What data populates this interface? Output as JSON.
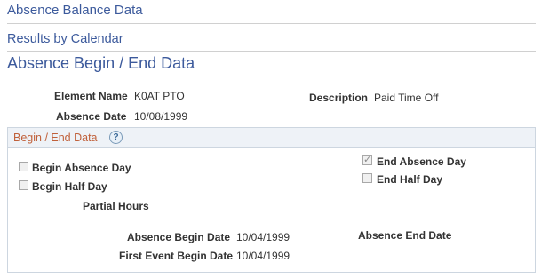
{
  "header": {
    "breadcrumb_label": "Absence Balance Data",
    "subtitle_link": "Results by Calendar",
    "page_title": "Absence Begin / End Data"
  },
  "fields": {
    "element_name_label": "Element Name",
    "element_name_value": "K0AT PTO",
    "description_label": "Description",
    "description_value": "Paid Time Off",
    "absence_date_label": "Absence Date",
    "absence_date_value": "10/08/1999"
  },
  "section": {
    "title": "Begin / End Data",
    "help_glyph": "?",
    "begin_absence_day": {
      "label": "Begin Absence Day",
      "checked": false
    },
    "begin_half_day": {
      "label": "Begin Half Day",
      "checked": false
    },
    "end_absence_day": {
      "label": "End Absence Day",
      "checked": true
    },
    "end_half_day": {
      "label": "End Half Day",
      "checked": false
    },
    "partial_hours_label": "Partial Hours",
    "absence_begin_date_label": "Absence Begin Date",
    "absence_begin_date_value": "10/04/1999",
    "absence_end_date_label": "Absence End Date",
    "first_event_begin_date_label": "First Event Begin Date",
    "first_event_begin_date_value": "10/04/1999"
  },
  "colors": {
    "link_blue": "#3c5a9c",
    "section_title_orange": "#c0603a",
    "section_header_bg": "#eef2f7"
  }
}
